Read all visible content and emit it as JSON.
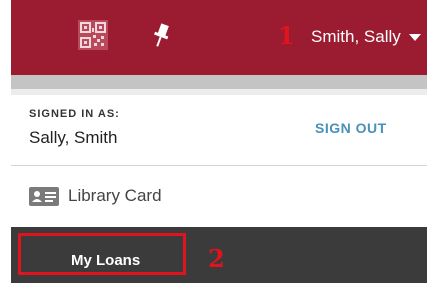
{
  "header": {
    "qr_icon": "qr-code-icon",
    "pin_icon": "pin-icon",
    "user_name": "Smith, Sally",
    "marker_1": "1",
    "colors": {
      "bar": "#9b1b30",
      "text": "#ffffff"
    }
  },
  "account": {
    "signed_in_label": "SIGNED IN AS:",
    "signed_in_name": "Sally, Smith",
    "sign_out_label": "SIGN OUT"
  },
  "menu": {
    "library_card_label": "Library Card",
    "library_card_icon": "id-card-icon",
    "my_loans_label": "My Loans",
    "marker_2": "2"
  },
  "annotation_color": "#e0141e"
}
